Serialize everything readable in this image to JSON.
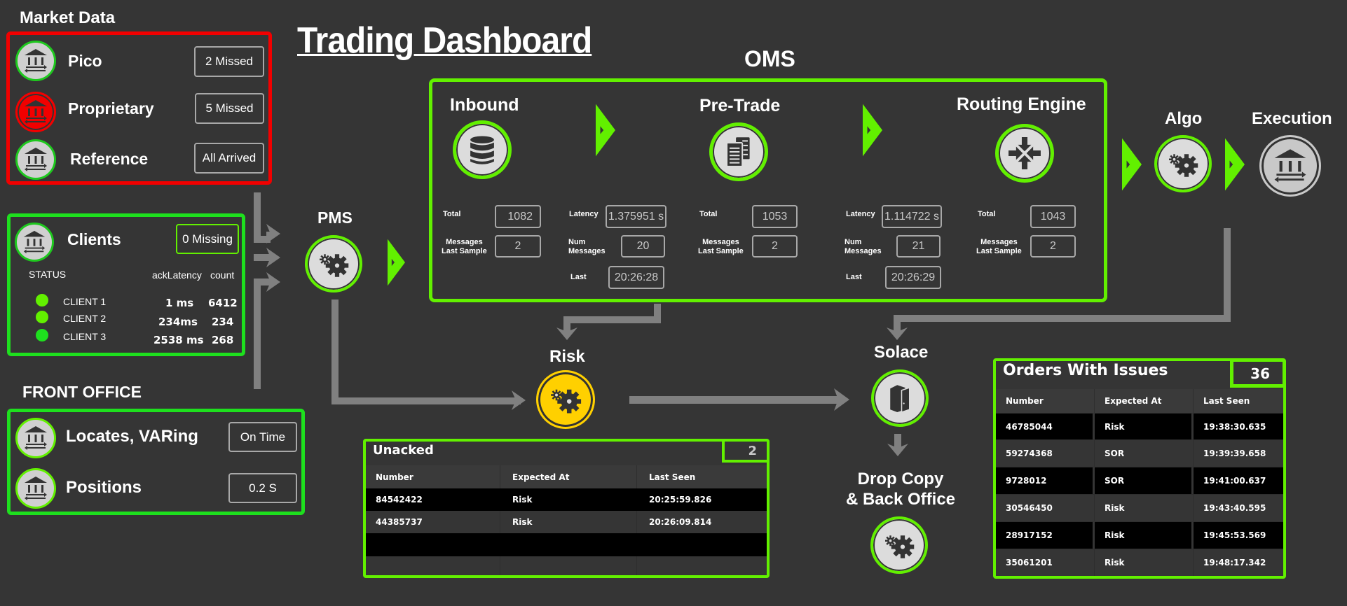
{
  "title": "Trading Dashboard",
  "market_data": {
    "heading": "Market Data",
    "items": [
      {
        "name": "Pico",
        "status": "2 Missed",
        "icon": "bank-exchange-icon",
        "state": "ok"
      },
      {
        "name": "Proprietary",
        "status": "5 Missed",
        "icon": "bank-exchange-icon",
        "state": "error"
      },
      {
        "name": "Reference",
        "status": "All Arrived",
        "icon": "bank-exchange-icon",
        "state": "ok"
      }
    ]
  },
  "clients": {
    "name": "Clients",
    "status": "0 Missing",
    "col_status": "STATUS",
    "col_latency": "ackLatency",
    "col_count": "count",
    "rows": [
      {
        "name": "CLIENT 1",
        "latency": "1 ms",
        "count": "6412"
      },
      {
        "name": "CLIENT 2",
        "latency": "234ms",
        "count": "234"
      },
      {
        "name": "CLIENT 3",
        "latency": "2538 ms",
        "count": "268"
      }
    ]
  },
  "front_office": {
    "heading": "FRONT OFFICE",
    "items": [
      {
        "name": "Locates, VARing",
        "status": "On Time"
      },
      {
        "name": "Positions",
        "status": "0.2 S"
      }
    ]
  },
  "pms": {
    "label": "PMS"
  },
  "oms": {
    "heading": "OMS",
    "stages": [
      {
        "name": "Inbound",
        "total_label": "Total",
        "total": "1082",
        "msgs_label": "Messages\nLast Sample",
        "msgs": "2"
      },
      {
        "name": "Pre-Trade",
        "total_label": "Total",
        "total": "1053",
        "msgs_label": "Messages\nLast Sample",
        "msgs": "2"
      },
      {
        "name": "Routing Engine",
        "total_label": "Total",
        "total": "1043",
        "msgs_label": "Messages\nLast Sample",
        "msgs": "2"
      }
    ],
    "links": [
      {
        "latency_label": "Latency",
        "latency": "1.375951 s",
        "num_label": "Num\nMessages",
        "num": "20",
        "last_label": "Last",
        "last": "20:26:28"
      },
      {
        "latency_label": "Latency",
        "latency": "1.114722 s",
        "num_label": "Num\nMessages",
        "num": "21",
        "last_label": "Last",
        "last": "20:26:29"
      }
    ]
  },
  "algo": {
    "label": "Algo"
  },
  "execution": {
    "label": "Execution"
  },
  "risk": {
    "label": "Risk"
  },
  "solace": {
    "label": "Solace"
  },
  "drop_copy": {
    "label_line1": "Drop Copy",
    "label_line2": "& Back Office"
  },
  "unacked": {
    "title": "Unacked",
    "count": "2",
    "columns": [
      "Number",
      "Expected At",
      "Last Seen"
    ],
    "rows": [
      [
        "84542422",
        "Risk",
        "20:25:59.826"
      ],
      [
        "44385737",
        "Risk",
        "20:26:09.814"
      ],
      [
        "",
        "",
        ""
      ],
      [
        "",
        "",
        ""
      ]
    ]
  },
  "orders_with_issues": {
    "title": "Orders With Issues",
    "count": "36",
    "columns": [
      "Number",
      "Expected At",
      "Last Seen"
    ],
    "rows": [
      [
        "46785044",
        "Risk",
        "19:38:30.635"
      ],
      [
        "59274368",
        "SOR",
        "19:39:39.658"
      ],
      [
        "9728012",
        "SOR",
        "19:41:00.637"
      ],
      [
        "30546450",
        "Risk",
        "19:43:40.595"
      ],
      [
        "28917152",
        "Risk",
        "19:45:53.569"
      ],
      [
        "35061201",
        "Risk",
        "19:48:17.342"
      ]
    ]
  },
  "colors": {
    "ok": "#62f000",
    "error": "#f20000",
    "warning": "#ffd000",
    "neutral": "#c0c0c0",
    "background": "#353535",
    "pipe": "#808080"
  }
}
